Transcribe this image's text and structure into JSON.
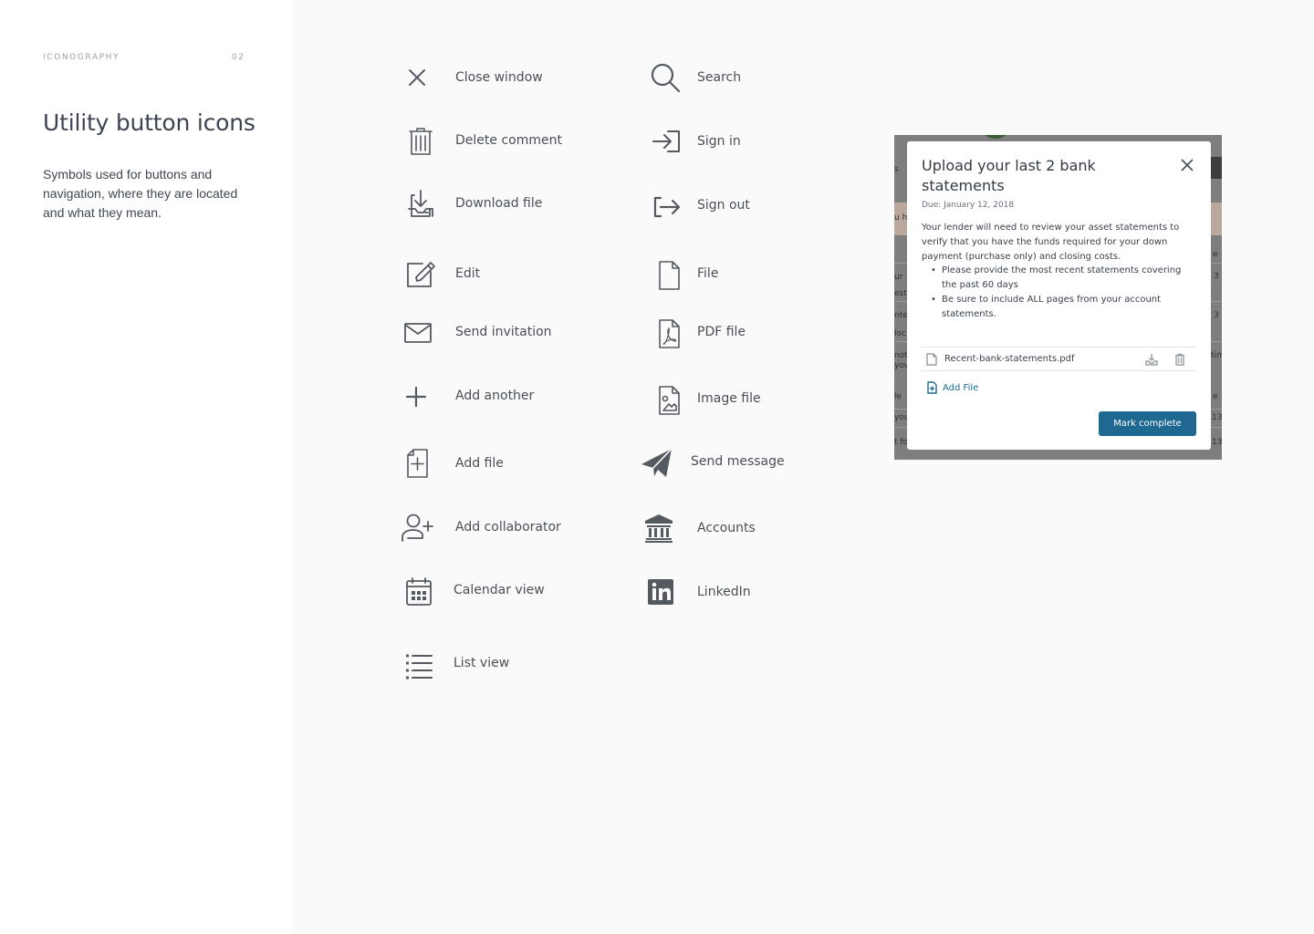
{
  "sidebar": {
    "eyebrow": "ICONOGRAPHY",
    "page_number": "02",
    "title": "Utility button icons",
    "description": "Symbols used for buttons and navigation, where they are located and what they mean."
  },
  "icons": {
    "close": {
      "label": "Close window",
      "icon": "close-icon"
    },
    "delete": {
      "label": "Delete comment",
      "icon": "trash-icon"
    },
    "download": {
      "label": "Download file",
      "icon": "download-icon"
    },
    "edit": {
      "label": "Edit",
      "icon": "edit-icon"
    },
    "invite": {
      "label": "Send invitation",
      "icon": "envelope-icon"
    },
    "add_another": {
      "label": "Add another",
      "icon": "plus-icon"
    },
    "add_file": {
      "label": "Add file",
      "icon": "file-plus-icon"
    },
    "add_collaborator": {
      "label": "Add collaborator",
      "icon": "user-plus-icon"
    },
    "calendar": {
      "label": "Calendar view",
      "icon": "calendar-icon"
    },
    "list": {
      "label": "List view",
      "icon": "list-icon"
    },
    "search": {
      "label": "Search",
      "icon": "search-icon"
    },
    "sign_in": {
      "label": "Sign in",
      "icon": "sign-in-icon"
    },
    "sign_out": {
      "label": "Sign out",
      "icon": "sign-out-icon"
    },
    "file": {
      "label": "File",
      "icon": "file-icon"
    },
    "pdf": {
      "label": "PDF file",
      "icon": "pdf-file-icon"
    },
    "image": {
      "label": "Image file",
      "icon": "image-file-icon"
    },
    "send": {
      "label": "Send message",
      "icon": "paper-plane-icon"
    },
    "accounts": {
      "label": "Accounts",
      "icon": "bank-icon"
    },
    "linkedin": {
      "label": "LinkedIn",
      "icon": "linkedin-icon"
    }
  },
  "modal": {
    "title": "Upload your last 2 bank statements",
    "due": "Due: January 12, 2018",
    "body": "Your lender will need to review your asset statements to verify that you have the funds required for your down payment (purchase only) and closing costs.",
    "bullets": [
      "Please provide the most recent statements covering the past 60 days",
      "Be sure to include ALL pages from your account statements."
    ],
    "file_name": "Recent-bank-statements.pdf",
    "add_file": "Add File",
    "complete_button": "Mark complete"
  },
  "background_fragments": [
    "s",
    "u h",
    "ur",
    "est",
    "nte",
    "loc",
    "not",
    "you",
    "le",
    "you",
    "t fo",
    "e",
    "3",
    "3",
    "tim",
    "e",
    "13",
    "13"
  ]
}
